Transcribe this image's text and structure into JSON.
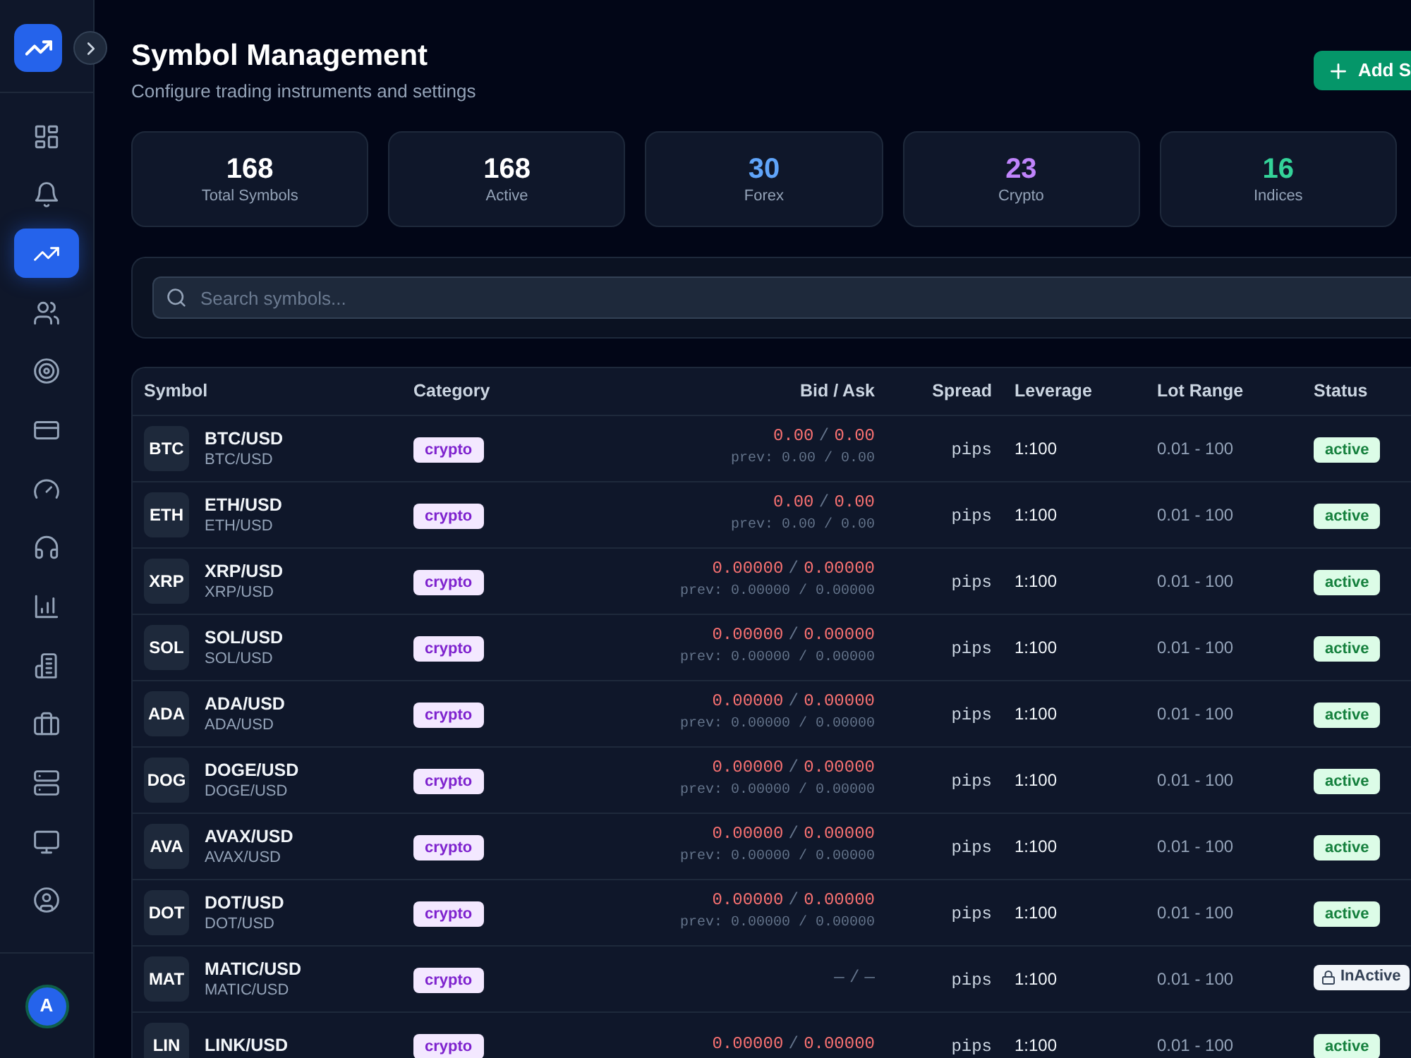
{
  "sidebar": {
    "items": [
      {
        "selected": false
      },
      {
        "selected": false
      },
      {
        "selected": true
      },
      {
        "selected": false
      },
      {
        "selected": false
      },
      {
        "selected": false
      },
      {
        "selected": false
      },
      {
        "selected": false
      },
      {
        "selected": false
      },
      {
        "selected": false
      },
      {
        "selected": false
      },
      {
        "selected": false
      },
      {
        "selected": false
      },
      {
        "selected": false
      }
    ],
    "user": {
      "initial": "A"
    }
  },
  "header": {
    "title": "Symbol Management",
    "subtitle": "Configure trading instruments and settings",
    "action": "Add S"
  },
  "stats": [
    {
      "value": "168",
      "label": "Total Symbols",
      "color": "#ffffff"
    },
    {
      "value": "168",
      "label": "Active",
      "color": "#ffffff"
    },
    {
      "value": "30",
      "label": "Forex",
      "color": "#60a5fa"
    },
    {
      "value": "23",
      "label": "Crypto",
      "color": "#c084fc"
    },
    {
      "value": "16",
      "label": "Indices",
      "color": "#34d399"
    }
  ],
  "search": {
    "placeholder": "Search symbols..."
  },
  "table": {
    "columns": [
      "Symbol",
      "Category",
      "Bid / Ask",
      "Spread",
      "Leverage",
      "Lot Range",
      "Status"
    ],
    "rows": [
      {
        "code": "BTC",
        "name": "BTC/USD",
        "subname": "BTC/USD",
        "category": "crypto",
        "quote": {
          "kind": "live",
          "bid": "0.00",
          "separator": "/",
          "ask": "0.00",
          "prev": "prev: 0.00 / 0.00"
        },
        "spread": "pips",
        "leverage": "1:100",
        "lot_range": "0.01 - 100",
        "status": {
          "label": "active",
          "active": true
        }
      },
      {
        "code": "ETH",
        "name": "ETH/USD",
        "subname": "ETH/USD",
        "category": "crypto",
        "quote": {
          "kind": "live",
          "bid": "0.00",
          "separator": "/",
          "ask": "0.00",
          "prev": "prev: 0.00 / 0.00"
        },
        "spread": "pips",
        "leverage": "1:100",
        "lot_range": "0.01 - 100",
        "status": {
          "label": "active",
          "active": true
        }
      },
      {
        "code": "XRP",
        "name": "XRP/USD",
        "subname": "XRP/USD",
        "category": "crypto",
        "quote": {
          "kind": "live",
          "bid": "0.00000",
          "separator": "/",
          "ask": "0.00000",
          "prev": "prev: 0.00000 / 0.00000"
        },
        "spread": "pips",
        "leverage": "1:100",
        "lot_range": "0.01 - 100",
        "status": {
          "label": "active",
          "active": true
        }
      },
      {
        "code": "SOL",
        "name": "SOL/USD",
        "subname": "SOL/USD",
        "category": "crypto",
        "quote": {
          "kind": "live",
          "bid": "0.00000",
          "separator": "/",
          "ask": "0.00000",
          "prev": "prev: 0.00000 / 0.00000"
        },
        "spread": "pips",
        "leverage": "1:100",
        "lot_range": "0.01 - 100",
        "status": {
          "label": "active",
          "active": true
        }
      },
      {
        "code": "ADA",
        "name": "ADA/USD",
        "subname": "ADA/USD",
        "category": "crypto",
        "quote": {
          "kind": "live",
          "bid": "0.00000",
          "separator": "/",
          "ask": "0.00000",
          "prev": "prev: 0.00000 / 0.00000"
        },
        "spread": "pips",
        "leverage": "1:100",
        "lot_range": "0.01 - 100",
        "status": {
          "label": "active",
          "active": true
        }
      },
      {
        "code": "DOG",
        "name": "DOGE/USD",
        "subname": "DOGE/USD",
        "category": "crypto",
        "quote": {
          "kind": "live",
          "bid": "0.00000",
          "separator": "/",
          "ask": "0.00000",
          "prev": "prev: 0.00000 / 0.00000"
        },
        "spread": "pips",
        "leverage": "1:100",
        "lot_range": "0.01 - 100",
        "status": {
          "label": "active",
          "active": true
        }
      },
      {
        "code": "AVA",
        "name": "AVAX/USD",
        "subname": "AVAX/USD",
        "category": "crypto",
        "quote": {
          "kind": "live",
          "bid": "0.00000",
          "separator": "/",
          "ask": "0.00000",
          "prev": "prev: 0.00000 / 0.00000"
        },
        "spread": "pips",
        "leverage": "1:100",
        "lot_range": "0.01 - 100",
        "status": {
          "label": "active",
          "active": true
        }
      },
      {
        "code": "DOT",
        "name": "DOT/USD",
        "subname": "DOT/USD",
        "category": "crypto",
        "quote": {
          "kind": "live",
          "bid": "0.00000",
          "separator": "/",
          "ask": "0.00000",
          "prev": "prev: 0.00000 / 0.00000"
        },
        "spread": "pips",
        "leverage": "1:100",
        "lot_range": "0.01 - 100",
        "status": {
          "label": "active",
          "active": true
        }
      },
      {
        "code": "MAT",
        "name": "MATIC/USD",
        "subname": "MATIC/USD",
        "category": "crypto",
        "quote": {
          "kind": "empty",
          "bid": "—",
          "separator": "/",
          "ask": "—"
        },
        "spread": "pips",
        "leverage": "1:100",
        "lot_range": "0.01 - 100",
        "status": {
          "label": "InActive",
          "active": false
        }
      },
      {
        "code": "LIN",
        "name": "LINK/USD",
        "category": "crypto",
        "quote": {
          "kind": "live",
          "bid": "0.00000",
          "separator": "/",
          "ask": "0.00000"
        },
        "spread": "pips",
        "leverage": "1:100",
        "lot_range": "0.01 - 100",
        "status": {
          "label": "active",
          "active": true
        }
      }
    ]
  }
}
